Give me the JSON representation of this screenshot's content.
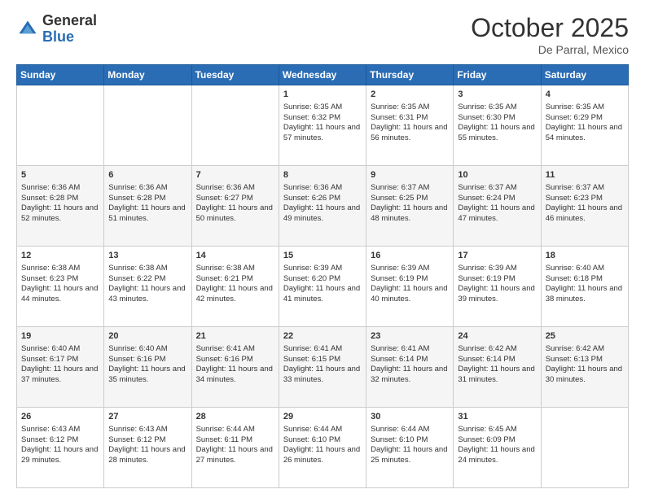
{
  "header": {
    "logo_general": "General",
    "logo_blue": "Blue",
    "month_title": "October 2025",
    "location": "De Parral, Mexico"
  },
  "days_of_week": [
    "Sunday",
    "Monday",
    "Tuesday",
    "Wednesday",
    "Thursday",
    "Friday",
    "Saturday"
  ],
  "weeks": [
    [
      {
        "day": "",
        "sunrise": "",
        "sunset": "",
        "daylight": ""
      },
      {
        "day": "",
        "sunrise": "",
        "sunset": "",
        "daylight": ""
      },
      {
        "day": "",
        "sunrise": "",
        "sunset": "",
        "daylight": ""
      },
      {
        "day": "1",
        "sunrise": "Sunrise: 6:35 AM",
        "sunset": "Sunset: 6:32 PM",
        "daylight": "Daylight: 11 hours and 57 minutes."
      },
      {
        "day": "2",
        "sunrise": "Sunrise: 6:35 AM",
        "sunset": "Sunset: 6:31 PM",
        "daylight": "Daylight: 11 hours and 56 minutes."
      },
      {
        "day": "3",
        "sunrise": "Sunrise: 6:35 AM",
        "sunset": "Sunset: 6:30 PM",
        "daylight": "Daylight: 11 hours and 55 minutes."
      },
      {
        "day": "4",
        "sunrise": "Sunrise: 6:35 AM",
        "sunset": "Sunset: 6:29 PM",
        "daylight": "Daylight: 11 hours and 54 minutes."
      }
    ],
    [
      {
        "day": "5",
        "sunrise": "Sunrise: 6:36 AM",
        "sunset": "Sunset: 6:28 PM",
        "daylight": "Daylight: 11 hours and 52 minutes."
      },
      {
        "day": "6",
        "sunrise": "Sunrise: 6:36 AM",
        "sunset": "Sunset: 6:28 PM",
        "daylight": "Daylight: 11 hours and 51 minutes."
      },
      {
        "day": "7",
        "sunrise": "Sunrise: 6:36 AM",
        "sunset": "Sunset: 6:27 PM",
        "daylight": "Daylight: 11 hours and 50 minutes."
      },
      {
        "day": "8",
        "sunrise": "Sunrise: 6:36 AM",
        "sunset": "Sunset: 6:26 PM",
        "daylight": "Daylight: 11 hours and 49 minutes."
      },
      {
        "day": "9",
        "sunrise": "Sunrise: 6:37 AM",
        "sunset": "Sunset: 6:25 PM",
        "daylight": "Daylight: 11 hours and 48 minutes."
      },
      {
        "day": "10",
        "sunrise": "Sunrise: 6:37 AM",
        "sunset": "Sunset: 6:24 PM",
        "daylight": "Daylight: 11 hours and 47 minutes."
      },
      {
        "day": "11",
        "sunrise": "Sunrise: 6:37 AM",
        "sunset": "Sunset: 6:23 PM",
        "daylight": "Daylight: 11 hours and 46 minutes."
      }
    ],
    [
      {
        "day": "12",
        "sunrise": "Sunrise: 6:38 AM",
        "sunset": "Sunset: 6:23 PM",
        "daylight": "Daylight: 11 hours and 44 minutes."
      },
      {
        "day": "13",
        "sunrise": "Sunrise: 6:38 AM",
        "sunset": "Sunset: 6:22 PM",
        "daylight": "Daylight: 11 hours and 43 minutes."
      },
      {
        "day": "14",
        "sunrise": "Sunrise: 6:38 AM",
        "sunset": "Sunset: 6:21 PM",
        "daylight": "Daylight: 11 hours and 42 minutes."
      },
      {
        "day": "15",
        "sunrise": "Sunrise: 6:39 AM",
        "sunset": "Sunset: 6:20 PM",
        "daylight": "Daylight: 11 hours and 41 minutes."
      },
      {
        "day": "16",
        "sunrise": "Sunrise: 6:39 AM",
        "sunset": "Sunset: 6:19 PM",
        "daylight": "Daylight: 11 hours and 40 minutes."
      },
      {
        "day": "17",
        "sunrise": "Sunrise: 6:39 AM",
        "sunset": "Sunset: 6:19 PM",
        "daylight": "Daylight: 11 hours and 39 minutes."
      },
      {
        "day": "18",
        "sunrise": "Sunrise: 6:40 AM",
        "sunset": "Sunset: 6:18 PM",
        "daylight": "Daylight: 11 hours and 38 minutes."
      }
    ],
    [
      {
        "day": "19",
        "sunrise": "Sunrise: 6:40 AM",
        "sunset": "Sunset: 6:17 PM",
        "daylight": "Daylight: 11 hours and 37 minutes."
      },
      {
        "day": "20",
        "sunrise": "Sunrise: 6:40 AM",
        "sunset": "Sunset: 6:16 PM",
        "daylight": "Daylight: 11 hours and 35 minutes."
      },
      {
        "day": "21",
        "sunrise": "Sunrise: 6:41 AM",
        "sunset": "Sunset: 6:16 PM",
        "daylight": "Daylight: 11 hours and 34 minutes."
      },
      {
        "day": "22",
        "sunrise": "Sunrise: 6:41 AM",
        "sunset": "Sunset: 6:15 PM",
        "daylight": "Daylight: 11 hours and 33 minutes."
      },
      {
        "day": "23",
        "sunrise": "Sunrise: 6:41 AM",
        "sunset": "Sunset: 6:14 PM",
        "daylight": "Daylight: 11 hours and 32 minutes."
      },
      {
        "day": "24",
        "sunrise": "Sunrise: 6:42 AM",
        "sunset": "Sunset: 6:14 PM",
        "daylight": "Daylight: 11 hours and 31 minutes."
      },
      {
        "day": "25",
        "sunrise": "Sunrise: 6:42 AM",
        "sunset": "Sunset: 6:13 PM",
        "daylight": "Daylight: 11 hours and 30 minutes."
      }
    ],
    [
      {
        "day": "26",
        "sunrise": "Sunrise: 6:43 AM",
        "sunset": "Sunset: 6:12 PM",
        "daylight": "Daylight: 11 hours and 29 minutes."
      },
      {
        "day": "27",
        "sunrise": "Sunrise: 6:43 AM",
        "sunset": "Sunset: 6:12 PM",
        "daylight": "Daylight: 11 hours and 28 minutes."
      },
      {
        "day": "28",
        "sunrise": "Sunrise: 6:44 AM",
        "sunset": "Sunset: 6:11 PM",
        "daylight": "Daylight: 11 hours and 27 minutes."
      },
      {
        "day": "29",
        "sunrise": "Sunrise: 6:44 AM",
        "sunset": "Sunset: 6:10 PM",
        "daylight": "Daylight: 11 hours and 26 minutes."
      },
      {
        "day": "30",
        "sunrise": "Sunrise: 6:44 AM",
        "sunset": "Sunset: 6:10 PM",
        "daylight": "Daylight: 11 hours and 25 minutes."
      },
      {
        "day": "31",
        "sunrise": "Sunrise: 6:45 AM",
        "sunset": "Sunset: 6:09 PM",
        "daylight": "Daylight: 11 hours and 24 minutes."
      },
      {
        "day": "",
        "sunrise": "",
        "sunset": "",
        "daylight": ""
      }
    ]
  ]
}
